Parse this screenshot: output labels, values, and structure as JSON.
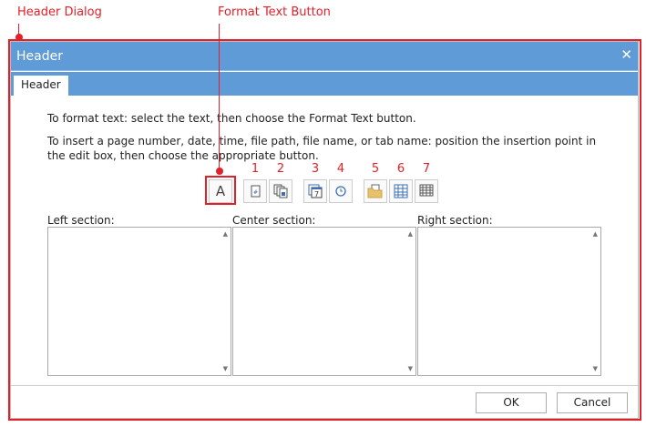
{
  "annotations": {
    "dialog": "Header Dialog",
    "format_button": "Format Text Button",
    "numbers": [
      "1",
      "2",
      "3",
      "4",
      "5",
      "6",
      "7"
    ]
  },
  "dialog": {
    "title": "Header",
    "tab": "Header",
    "instruction1": "To format text: select the text, then choose the Format Text button.",
    "instruction2": "To insert a page number, date, time, file path, file name, or tab name: position the insertion point in the edit box, then choose the appropriate button.",
    "format_label": "A",
    "sections": {
      "left": "Left section:",
      "center": "Center section:",
      "right": "Right section:"
    },
    "ok": "OK",
    "cancel": "Cancel"
  },
  "colors": {
    "accent": "#5f9bd6",
    "annotation": "#e3202a"
  }
}
